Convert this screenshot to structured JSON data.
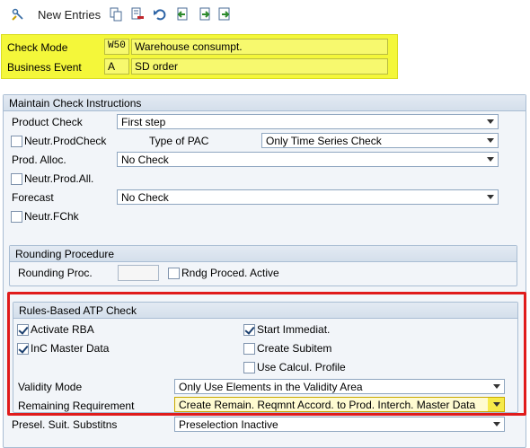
{
  "toolbar": {
    "new_entries_label": "New Entries",
    "icons": [
      "display-change-icon",
      "copy-icon",
      "delete-icon",
      "undo-icon",
      "previous-entry-icon",
      "next-entry-icon",
      "select-all-icon"
    ]
  },
  "header": {
    "check_mode_label": "Check Mode",
    "check_mode_value": "W50",
    "check_mode_desc": "Warehouse consumpt.",
    "business_event_label": "Business Event",
    "business_event_value": "A",
    "business_event_desc": "SD order"
  },
  "maintain": {
    "title": "Maintain Check Instructions",
    "product_check_label": "Product Check",
    "product_check_value": "First step",
    "neutr_prodcheck_label": "Neutr.ProdCheck",
    "type_of_pac_label": "Type of PAC",
    "type_of_pac_value": "Only Time Series Check",
    "prod_alloc_label": "Prod. Alloc.",
    "prod_alloc_value": "No Check",
    "neutr_prod_all_label": "Neutr.Prod.All.",
    "forecast_label": "Forecast",
    "forecast_value": "No Check",
    "neutr_fchk_label": "Neutr.FChk"
  },
  "rounding": {
    "title": "Rounding Procedure",
    "proc_label": "Rounding Proc.",
    "proc_value": "",
    "active_label": "Rndg Proced. Active"
  },
  "rba": {
    "title": "Rules-Based ATP Check",
    "activate_rba_label": "Activate RBA",
    "inc_master_data_label": "InC Master Data",
    "start_immediat_label": "Start Immediat.",
    "create_subitem_label": "Create Subitem",
    "use_calcul_profile_label": "Use Calcul. Profile",
    "validity_mode_label": "Validity Mode",
    "validity_mode_value": "Only Use Elements in the Validity Area",
    "remaining_req_label": "Remaining Requirement",
    "remaining_req_value": "Create Remain. Reqmnt Accord. to Prod. Interch. Master Data"
  },
  "presel": {
    "label": "Presel. Suit. Substitns",
    "value": "Preselection Inactive"
  },
  "colors": {
    "highlight": "#f4f73a",
    "annotation": "#e01b1b",
    "group_border": "#a9bdd3"
  }
}
